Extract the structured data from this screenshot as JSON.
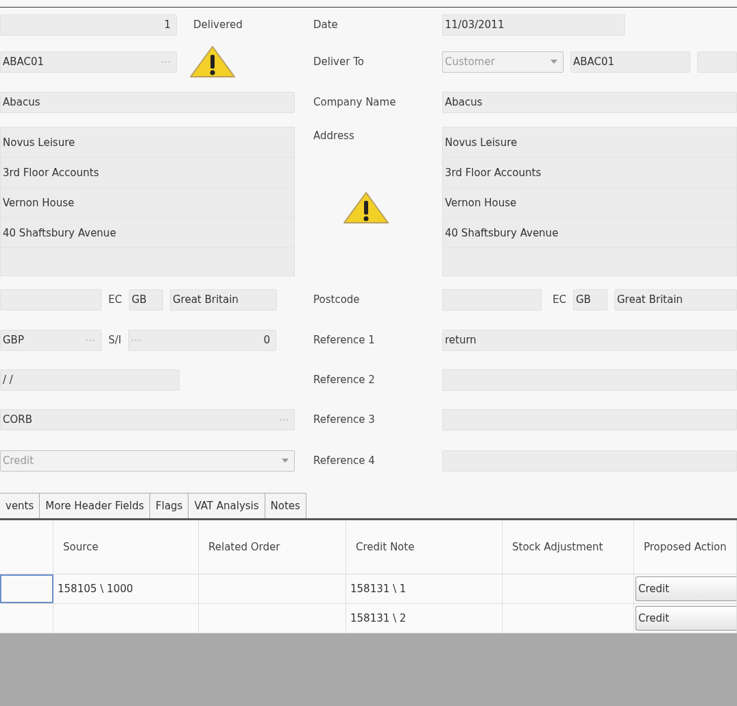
{
  "header": {
    "number": {
      "value": "1"
    },
    "status": {
      "label": "Delivered",
      "warning": true
    },
    "account": {
      "value": "ABAC01"
    },
    "company": {
      "value": "Abacus"
    },
    "address": [
      "Novus Leisure",
      "3rd Floor Accounts",
      "Vernon House",
      "40 Shaftsbury Avenue"
    ],
    "country_row": {
      "ec_label": "EC",
      "country_code": "GB",
      "country": "Great Britain"
    },
    "currency": {
      "value": "GBP"
    },
    "si": {
      "label": "S/I",
      "value": "0"
    },
    "date_field": {
      "value": "/ /"
    },
    "code": {
      "value": "CORB"
    },
    "type": {
      "value": "Credit",
      "disabled": true
    }
  },
  "delivery": {
    "date": {
      "label": "Date",
      "value": "11/03/2011"
    },
    "deliver_to": {
      "label": "Deliver To",
      "type": "Customer",
      "type_disabled": true,
      "account": "ABAC01"
    },
    "company": {
      "label": "Company Name",
      "value": "Abacus"
    },
    "address": {
      "label": "Address",
      "warning": true,
      "lines": [
        "Novus Leisure",
        "3rd Floor Accounts",
        "Vernon House",
        "40 Shaftsbury Avenue"
      ]
    },
    "postcode": {
      "label": "Postcode",
      "ec_label": "EC",
      "country_code": "GB",
      "country": "Great Britain"
    },
    "references": [
      {
        "label": "Reference 1",
        "value": "return"
      },
      {
        "label": "Reference 2"
      },
      {
        "label": "Reference 3"
      },
      {
        "label": "Reference 4"
      }
    ]
  },
  "tabs": [
    {
      "label": "vents"
    },
    {
      "label": "More Header Fields"
    },
    {
      "label": "Flags"
    },
    {
      "label": "VAT Analysis"
    },
    {
      "label": "Notes"
    }
  ],
  "table": {
    "columns": [
      "Source",
      "Related Order",
      "Credit Note",
      "Stock Adjustment",
      "Proposed Action"
    ],
    "rows": [
      {
        "focused": true,
        "source": "158105 \\ 1000",
        "credit_note": "158131 \\ 1",
        "action": "Credit"
      },
      {
        "focused": false,
        "credit_note": "158131 \\ 2",
        "action": "Credit"
      }
    ]
  }
}
